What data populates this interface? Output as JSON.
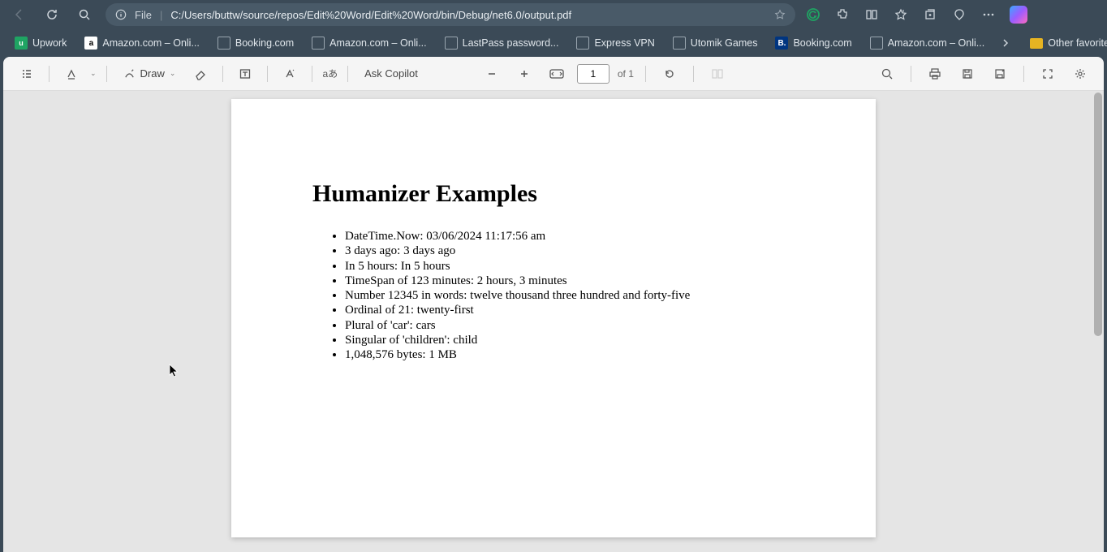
{
  "addressbar": {
    "protocol": "File",
    "url": "C:/Users/buttw/source/repos/Edit%20Word/Edit%20Word/bin/Debug/net6.0/output.pdf"
  },
  "bookmarks": {
    "items": [
      {
        "icon": "up",
        "label": "Upwork"
      },
      {
        "icon": "amz",
        "label": "Amazon.com – Onli..."
      },
      {
        "icon": "file",
        "label": "Booking.com"
      },
      {
        "icon": "file",
        "label": "Amazon.com – Onli..."
      },
      {
        "icon": "file",
        "label": "LastPass password..."
      },
      {
        "icon": "file",
        "label": "Express VPN"
      },
      {
        "icon": "file",
        "label": "Utomik Games"
      },
      {
        "icon": "book",
        "label": "Booking.com"
      },
      {
        "icon": "file",
        "label": "Amazon.com – Onli..."
      }
    ],
    "other": "Other favorites"
  },
  "toolbar": {
    "draw": "Draw",
    "askCopilot": "Ask Copilot",
    "pageInput": "1",
    "pageTotal": "of 1"
  },
  "document": {
    "title": "Humanizer Examples",
    "items": [
      "DateTime.Now: 03/06/2024 11:17:56 am",
      "3 days ago: 3 days ago",
      "In 5 hours: In 5 hours",
      "TimeSpan of 123 minutes: 2 hours, 3 minutes",
      "Number 12345 in words: twelve thousand three hundred and forty-five",
      "Ordinal of 21: twenty-first",
      "Plural of 'car': cars",
      "Singular of 'children': child",
      "1,048,576 bytes: 1 MB"
    ]
  }
}
